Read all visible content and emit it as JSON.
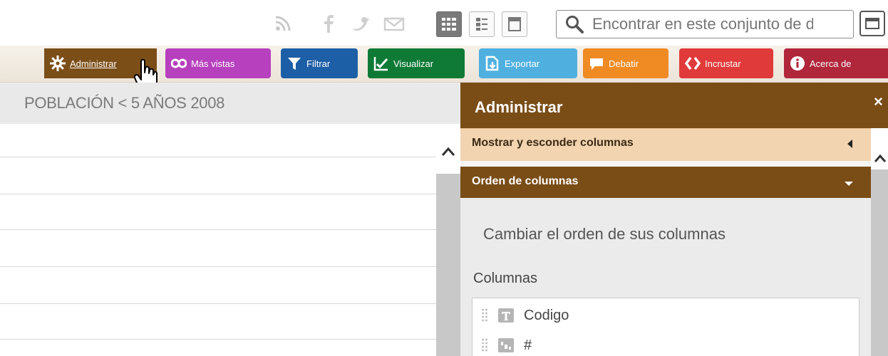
{
  "topbar": {
    "social_icons": [
      "rss-icon",
      "facebook-icon",
      "twitter-icon",
      "mail-icon"
    ],
    "view_modes": [
      "grid-view-icon",
      "page-view-icon",
      "fatrow-view-icon"
    ],
    "active_view": "grid-view-icon",
    "search": {
      "placeholder": "Encontrar en este conjunto de datos",
      "icon": "search-icon"
    },
    "fullscreen_icon": "fullscreen-icon"
  },
  "actions": {
    "admin": "Administrar",
    "more_views": "Más vistas",
    "filter": "Filtrar",
    "visualize": "Visualizar",
    "export": "Exportar",
    "debate": "Debatir",
    "embed": "Incrustar",
    "about": "Acerca de"
  },
  "colors": {
    "admin": "#7b4e18",
    "more_views": "#b640bd",
    "filter": "#1d5fa6",
    "visualize": "#0f7a36",
    "export": "#4fb0e0",
    "debate": "#f08a23",
    "embed": "#e03a3a",
    "about": "#b0263a",
    "panel_header": "#7a4d17",
    "section_open": "#f2d4b1"
  },
  "dataset": {
    "title": "POBLACIÓN < 5 AÑOS 2008"
  },
  "panel": {
    "title": "Administrar",
    "close": "×",
    "sections": [
      {
        "label": "Mostrar y esconder columnas",
        "state": "collapsed"
      },
      {
        "label": "Orden de columnas",
        "state": "expanded"
      }
    ],
    "description": "Cambiar el orden de sus columnas",
    "columns_label": "Columnas",
    "columns": [
      {
        "name": "Codigo",
        "type": "text-type-icon"
      },
      {
        "name": "#",
        "type": "number-type-icon"
      }
    ]
  }
}
